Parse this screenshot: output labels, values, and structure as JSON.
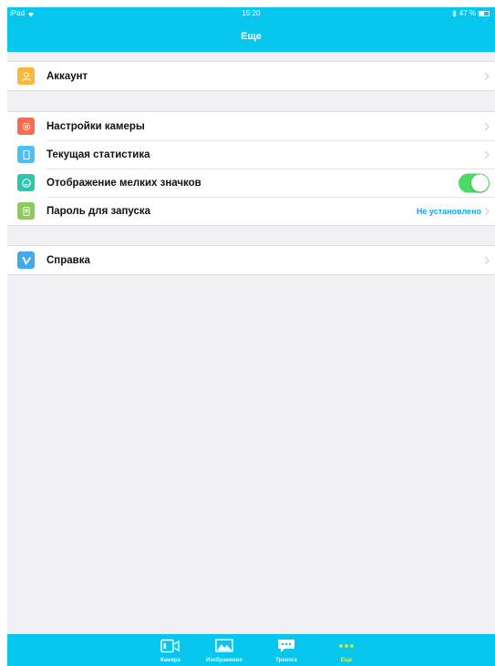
{
  "status_bar": {
    "device": "iPad",
    "time": "15:20",
    "battery_text": "47 %",
    "battery_level": 0.47
  },
  "nav": {
    "title": "Еще"
  },
  "sections": {
    "account": {
      "label": "Аккаунт"
    },
    "camera_settings": {
      "label": "Настройки камеры"
    },
    "current_stats": {
      "label": "Текущая статистика"
    },
    "small_icons": {
      "label": "Отображение мелких значков",
      "toggle_on": true
    },
    "launch_password": {
      "label": "Пароль для запуска",
      "value": "Не установлено"
    },
    "help": {
      "label": "Справка"
    }
  },
  "tabbar": {
    "tabs": [
      {
        "label": "Камера",
        "icon": "camera-icon"
      },
      {
        "label": "Изображение",
        "icon": "image-icon"
      },
      {
        "label": "Тревога",
        "icon": "alarm-message-icon"
      },
      {
        "label": "Еще",
        "icon": "more-icon",
        "active": true
      }
    ]
  },
  "colors": {
    "accent": "#06c6ee",
    "toggle_on": "#4cd964",
    "active_tab": "#f2ee20",
    "value_text": "#1aa6e8",
    "icon_account": "#fbb93a",
    "icon_camera_settings": "#f96c4e",
    "icon_stats": "#4fbef2",
    "icon_small_icons": "#2fc7ac",
    "icon_password": "#8ccb5a",
    "icon_help": "#42a9ea"
  }
}
